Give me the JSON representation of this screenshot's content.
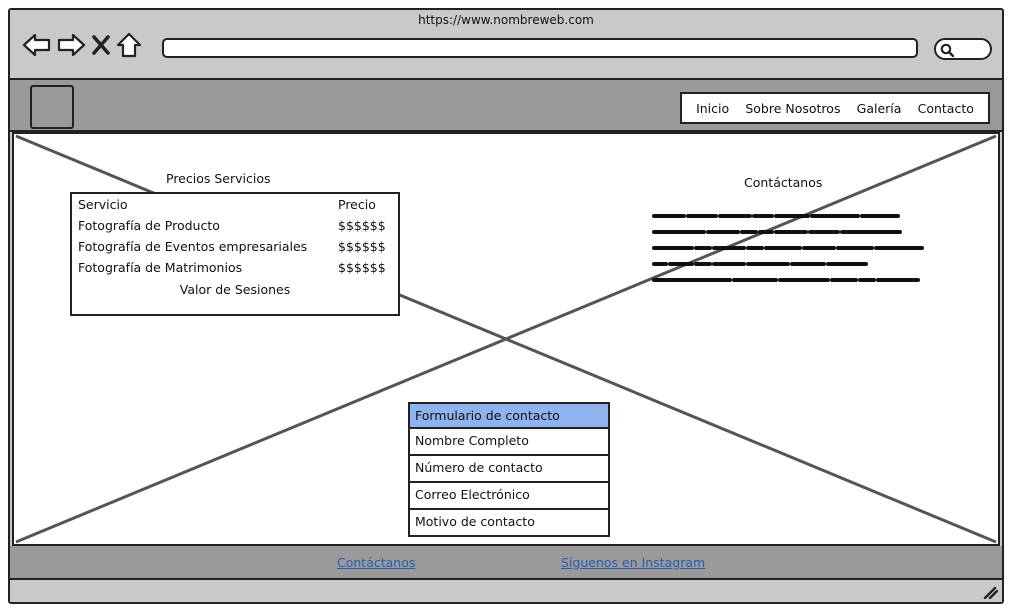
{
  "browser": {
    "url": "https://www.nombreweb.com",
    "icons": [
      "back-arrow-icon",
      "forward-arrow-icon",
      "close-icon",
      "home-icon",
      "search-icon"
    ]
  },
  "nav": {
    "items": [
      {
        "label": "Inicio"
      },
      {
        "label": "Sobre Nosotros"
      },
      {
        "label": "Galería"
      },
      {
        "label": "Contacto"
      }
    ]
  },
  "pricing": {
    "title": "Precios Servicios",
    "headers": {
      "service": "Servicio",
      "price": "Precio"
    },
    "rows": [
      {
        "service": "Fotografía de Producto",
        "price": "$$$$$$"
      },
      {
        "service": "Fotografía de Eventos empresariales",
        "price": "$$$$$$"
      },
      {
        "service": "Fotografía de Matrimonios",
        "price": "$$$$$$"
      }
    ],
    "footer": "Valor de Sesiones"
  },
  "contact": {
    "title": "Contáctanos"
  },
  "form": {
    "header": "Formulario de contacto",
    "fields": [
      {
        "label": "Nombre Completo"
      },
      {
        "label": "Número de contacto"
      },
      {
        "label": "Correo Electrónico"
      },
      {
        "label": "Motivo de contacto"
      }
    ],
    "header_color": "#8fb3ef"
  },
  "footer": {
    "links": [
      {
        "label": "Contáctanos"
      },
      {
        "label": "Síguenos en Instagram"
      }
    ],
    "link_color": "#2a5db0"
  }
}
